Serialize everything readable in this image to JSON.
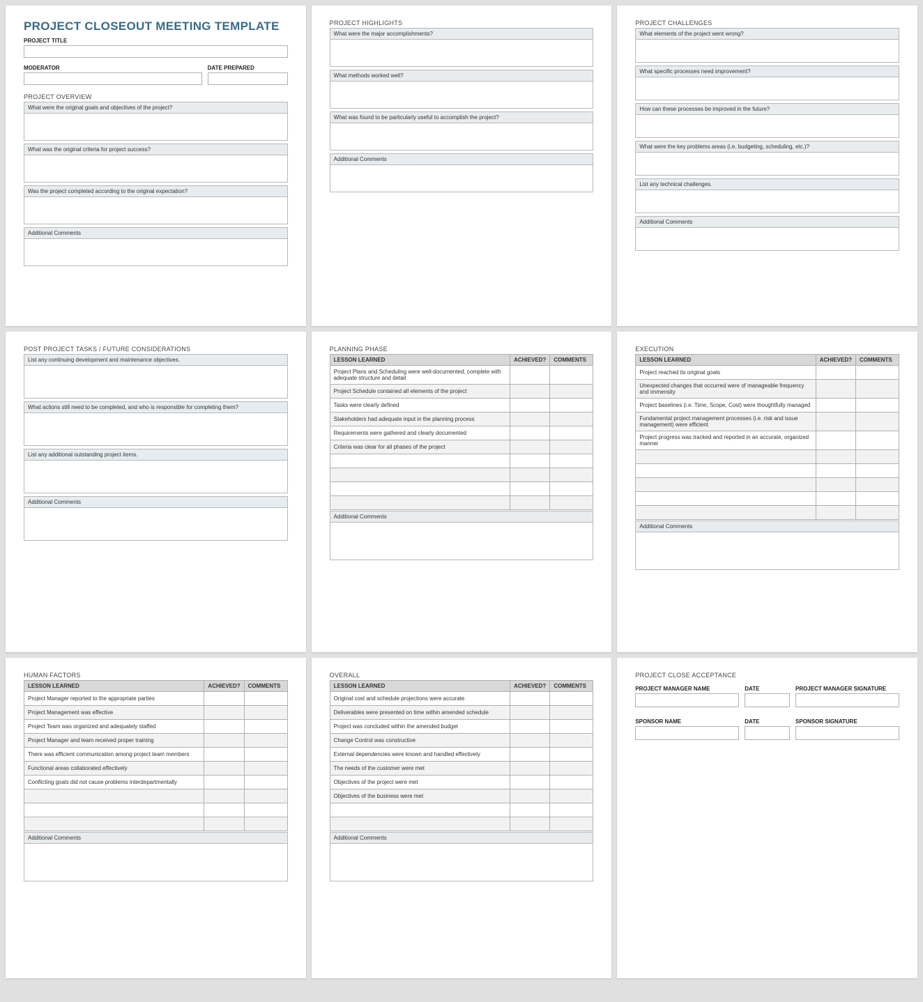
{
  "title": "PROJECT CLOSEOUT MEETING TEMPLATE",
  "labels": {
    "project_title": "PROJECT TITLE",
    "moderator": "MODERATOR",
    "date_prepared": "DATE PREPARED",
    "additional_comments": "Additional Comments",
    "lesson_learned": "LESSON LEARNED",
    "achieved": "ACHIEVED?",
    "comments": "COMMENTS"
  },
  "overview": {
    "header": "PROJECT OVERVIEW",
    "q1": "What were the original goals and objectives of the project?",
    "q2": "What was the original criteria for project success?",
    "q3": "Was the project completed according to the original expectation?"
  },
  "highlights": {
    "header": "PROJECT HIGHLIGHTS",
    "q1": "What were the major accomplishments?",
    "q2": "What methods worked well?",
    "q3": "What was found to be particularly useful to accomplish the project?"
  },
  "challenges": {
    "header": "PROJECT CHALLENGES",
    "q1": "What elements of the project went wrong?",
    "q2": "What specific processes need improvement?",
    "q3": "How can these processes be improved in the future?",
    "q4": "What were the key problems areas (i.e. budgeting, scheduling, etc.)?",
    "q5": "List any technical challenges."
  },
  "post": {
    "header": "POST PROJECT TASKS / FUTURE CONSIDERATIONS",
    "q1": "List any continuing development and maintenance objectives.",
    "q2": "What actions still need to be completed, and who is responsible for completing them?",
    "q3": "List any additional outstanding project items."
  },
  "planning": {
    "header": "PLANNING PHASE",
    "rows": [
      "Project Plans and Scheduling were well-documented, complete with adequate structure and detail",
      "Project Schedule contained all elements of the project",
      "Tasks were clearly defined",
      "Stakeholders had adequate input in the planning process",
      "Requirements were gathered and clearly documented",
      "Criteria was clear for all phases of the project",
      "",
      "",
      "",
      ""
    ]
  },
  "execution": {
    "header": "EXECUTION",
    "rows": [
      "Project reached its original goals",
      "Unexpected changes that occurred were of manageable frequency and immensity",
      "Project baselines (i.e. Time, Scope, Cost) were thoughtfully managed",
      "Fundamental project management processes (i.e. risk and issue management) were efficient",
      "Project progress was tracked and reported in an accurate, organized manner",
      "",
      "",
      "",
      "",
      ""
    ]
  },
  "human": {
    "header": "HUMAN FACTORS",
    "rows": [
      "Project Manager reported to the appropriate parties",
      "Project Management was effective",
      "Project Team was organized and adequately staffed",
      "Project Manager and team received proper training",
      "There was efficient communication among project team members",
      "Functional areas collaborated effectively",
      "Conflicting goals did not cause problems interdepartmentally",
      "",
      "",
      ""
    ]
  },
  "overall": {
    "header": "OVERALL",
    "rows": [
      "Original cost and schedule projections were accurate",
      "Deliverables were presented on time within amended schedule",
      "Project was concluded within the amended budget",
      "Change Control was constructive",
      "External dependencies were known and handled effectively",
      "The needs of the customer were met",
      "Objectives of the project were met",
      "Objectives of the business were met",
      "",
      ""
    ]
  },
  "acceptance": {
    "header": "PROJECT CLOSE ACCEPTANCE",
    "pm_name": "PROJECT MANAGER NAME",
    "date": "DATE",
    "pm_sig": "PROJECT MANAGER SIGNATURE",
    "sp_name": "SPONSOR NAME",
    "sp_sig": "SPONSOR SIGNATURE"
  }
}
